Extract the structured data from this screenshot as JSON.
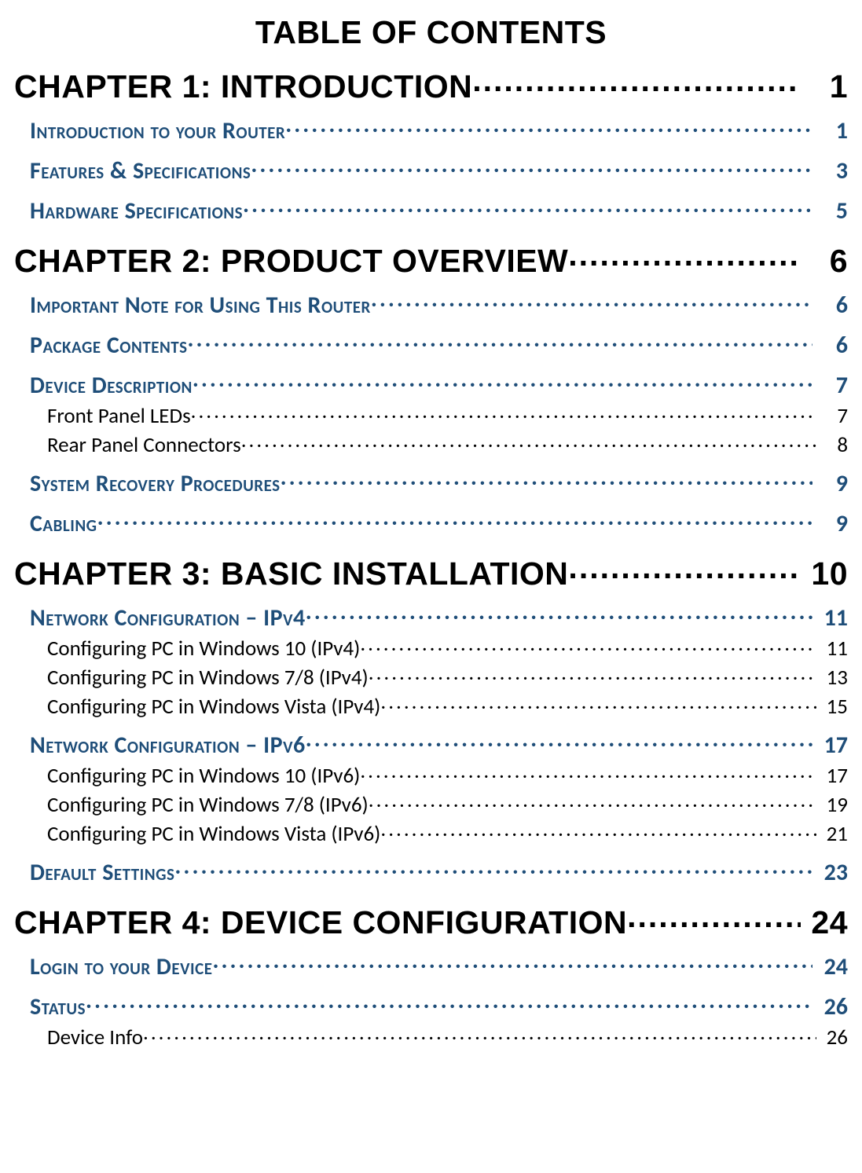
{
  "title": "TABLE OF CONTENTS",
  "chapters": [
    {
      "label": "CHAPTER 1: INTRODUCTION",
      "page": "1",
      "sections": [
        {
          "label": "Introduction to your Router",
          "page": "1",
          "subs": []
        },
        {
          "label": "Features & Specifications",
          "page": "3",
          "subs": []
        },
        {
          "label": "Hardware Specifications",
          "page": "5",
          "subs": []
        }
      ]
    },
    {
      "label": "CHAPTER 2: PRODUCT OVERVIEW",
      "page": "6",
      "sections": [
        {
          "label": "Important Note for Using This Router",
          "page": "6",
          "subs": []
        },
        {
          "label": "Package Contents",
          "page": "6",
          "subs": []
        },
        {
          "label": "Device Description",
          "page": "7",
          "subs": [
            {
              "label": "Front Panel LEDs",
              "page": "7"
            },
            {
              "label": "Rear Panel Connectors",
              "page": "8"
            }
          ]
        },
        {
          "label": "System Recovery Procedures",
          "page": "9",
          "subs": []
        },
        {
          "label": "Cabling",
          "page": "9",
          "subs": []
        }
      ]
    },
    {
      "label": "CHAPTER 3: BASIC INSTALLATION",
      "page": "10",
      "sections": [
        {
          "label": "Network Configuration – IPv4",
          "page": "11",
          "subs": [
            {
              "label": "Configuring PC in Windows 10 (IPv4)",
              "page": "11"
            },
            {
              "label": "Configuring PC in Windows 7/8 (IPv4)",
              "page": "13"
            },
            {
              "label": "Configuring PC in Windows Vista (IPv4)",
              "page": "15"
            }
          ]
        },
        {
          "label": "Network Configuration – IPv6",
          "page": "17",
          "subs": [
            {
              "label": "Configuring PC in Windows 10 (IPv6)",
              "page": "17"
            },
            {
              "label": "Configuring PC in Windows 7/8 (IPv6)",
              "page": "19"
            },
            {
              "label": "Configuring PC in Windows Vista (IPv6)",
              "page": "21"
            }
          ]
        },
        {
          "label": "Default Settings",
          "page": "23",
          "subs": []
        }
      ]
    },
    {
      "label": "CHAPTER 4: DEVICE CONFIGURATION",
      "page": "24",
      "sections": [
        {
          "label": "Login to your Device",
          "page": "24",
          "subs": []
        },
        {
          "label": "Status",
          "page": "26",
          "subs": [
            {
              "label": "Device Info",
              "page": "26"
            }
          ]
        }
      ]
    }
  ]
}
